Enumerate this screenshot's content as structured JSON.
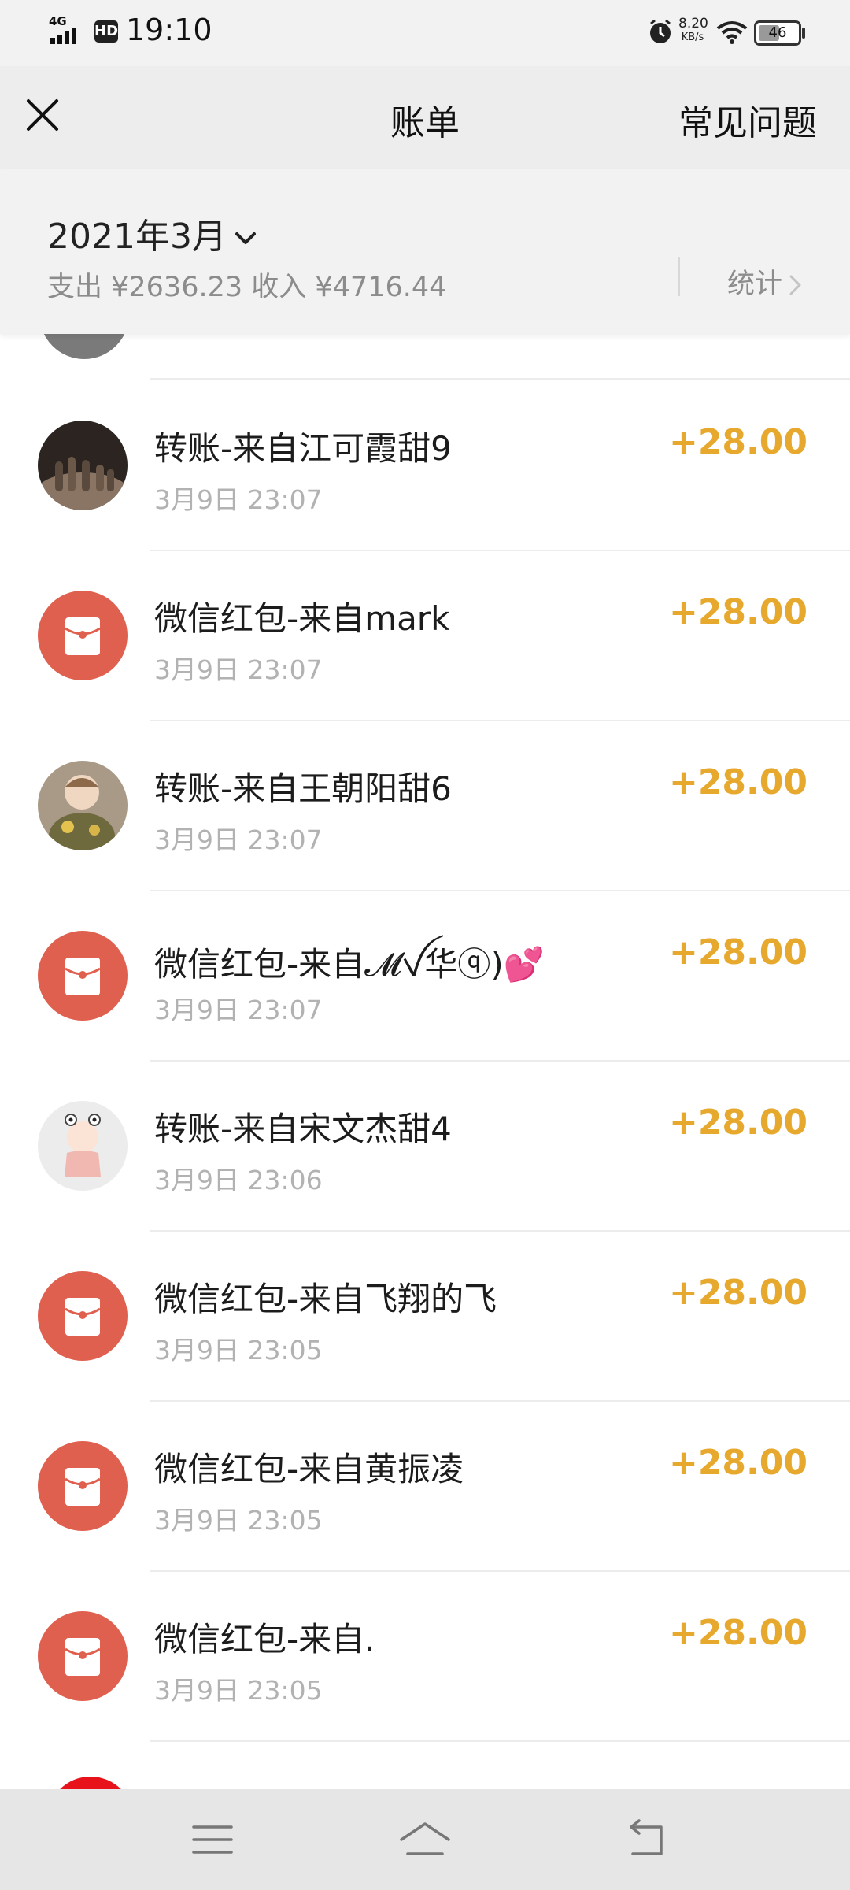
{
  "status_bar": {
    "network": "4G",
    "hd": "HD",
    "time": "19:10",
    "speed_value": "8.20",
    "speed_unit": "KB/s",
    "battery": "46"
  },
  "header": {
    "title": "账单",
    "faq": "常见问题",
    "close_icon": "close-icon"
  },
  "month": {
    "label": "2021年3月",
    "summary": "支出 ¥2636.23 收入 ¥4716.44",
    "stats": "统计"
  },
  "transactions": [
    {
      "name": "转账-来自江可霞甜9",
      "time": "3月9日 23:07",
      "amount": "+28.00",
      "avatar": "photo-desert"
    },
    {
      "name": "微信红包-来自mark",
      "time": "3月9日 23:07",
      "amount": "+28.00",
      "avatar": "red-envelope"
    },
    {
      "name": "转账-来自王朝阳甜6",
      "time": "3月9日 23:07",
      "amount": "+28.00",
      "avatar": "photo-child"
    },
    {
      "name": "微信红包-来自𝓜ꪜ华ⓠ)💕",
      "time": "3月9日 23:07",
      "amount": "+28.00",
      "avatar": "red-envelope"
    },
    {
      "name": "转账-来自宋文杰甜4",
      "time": "3月9日 23:06",
      "amount": "+28.00",
      "avatar": "photo-cartoon"
    },
    {
      "name": "微信红包-来自飞翔的飞",
      "time": "3月9日 23:05",
      "amount": "+28.00",
      "avatar": "red-envelope"
    },
    {
      "name": "微信红包-来自黄振凌",
      "time": "3月9日 23:05",
      "amount": "+28.00",
      "avatar": "red-envelope"
    },
    {
      "name": "微信红包-来自.",
      "time": "3月9日 23:05",
      "amount": "+28.00",
      "avatar": "red-envelope"
    }
  ],
  "colors": {
    "amount": "#e7a82e",
    "red_envelope": "#e0604f"
  },
  "bottom_nav": [
    "menu-icon",
    "home-icon",
    "back-icon"
  ]
}
